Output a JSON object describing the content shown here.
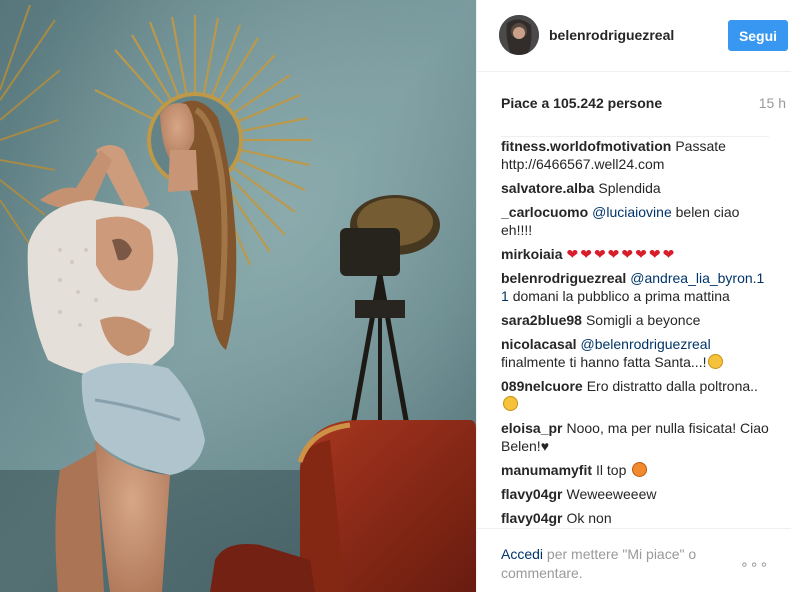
{
  "header": {
    "username": "belenrodriguezreal",
    "follow_label": "Segui"
  },
  "likes": {
    "text": "Piace a 105.242 persone",
    "time": "15 h"
  },
  "comments": [
    {
      "user": "fitness.worldofmotivation",
      "mention": "",
      "text": "Passate http://6466567.well24.com"
    },
    {
      "user": "salvatore.alba",
      "mention": "",
      "text": "Splendida"
    },
    {
      "user": "_carlocuomo",
      "mention": "@luciaiovine",
      "text": "belen ciao eh!!!!"
    },
    {
      "user": "mirkoiaia",
      "mention": "",
      "text": "❤❤❤❤❤❤❤❤"
    },
    {
      "user": "belenrodriguezreal",
      "mention": "@andrea_lia_byron.11",
      "text": "domani la pubblico a prima mattina"
    },
    {
      "user": "sara2blue98",
      "mention": "",
      "text": "Somigli a beyonce"
    },
    {
      "user": "nicolacasal",
      "mention": "@belenrodriguezreal",
      "text": "finalmente ti hanno fatta Santa...!"
    },
    {
      "user": "089nelcuore",
      "mention": "",
      "text": "Ero distratto dalla poltrona.."
    },
    {
      "user": "eloisa_pr",
      "mention": "",
      "text": "Nooo, ma per nulla fisicata! Ciao Belen!"
    },
    {
      "user": "manumamyfit",
      "mention": "",
      "text": "Il top"
    },
    {
      "user": "flavy04gr",
      "mention": "",
      "text": "Weweeweeew"
    },
    {
      "user": "flavy04gr",
      "mention": "",
      "text": "Ok non"
    }
  ],
  "footer": {
    "login_link": "Accedi",
    "text": "per mettere \"Mi piace\" o commentare.",
    "more_icon": "ellipsis-icon",
    "more_label": "∘∘∘"
  },
  "colors": {
    "follow_button": "#3897f0",
    "mention": "#003569",
    "muted": "#999999",
    "heart": "#d81e2b"
  }
}
